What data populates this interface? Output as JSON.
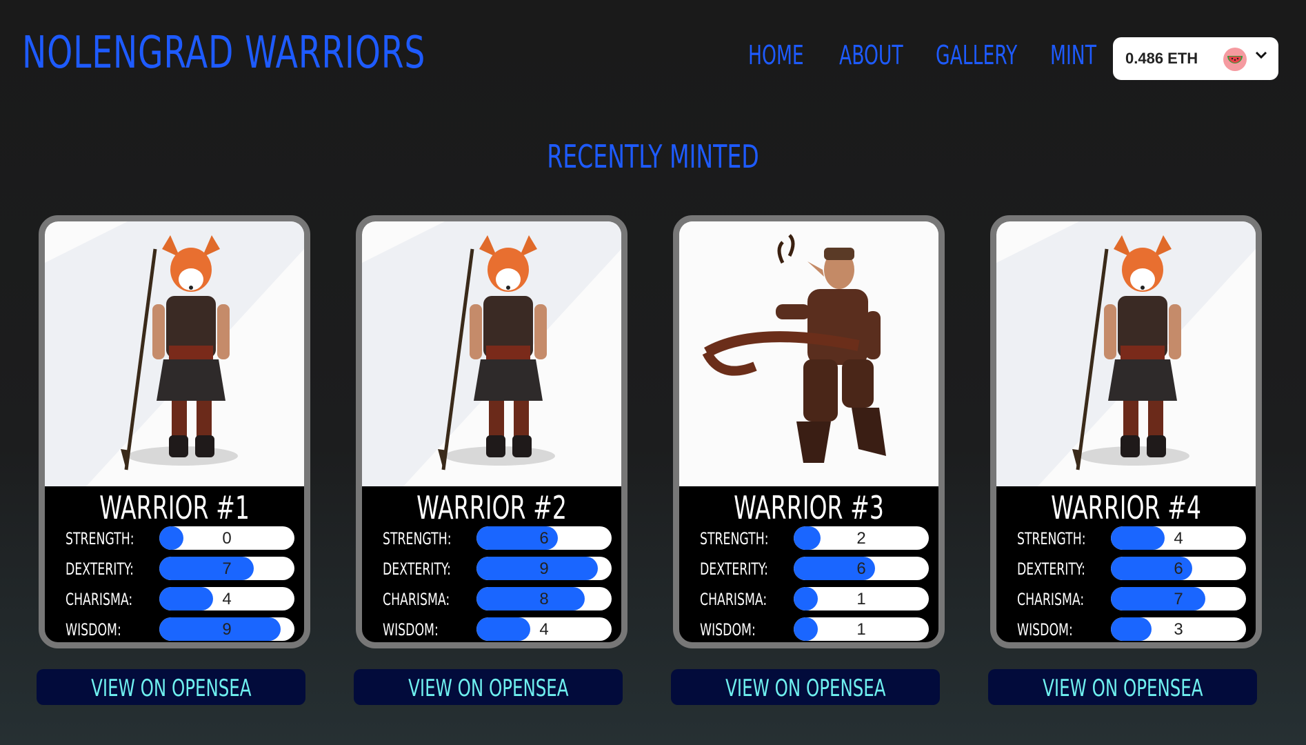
{
  "header": {
    "title": "NOLENGRAD WARRIORS",
    "nav": [
      "HOME",
      "ABOUT",
      "GALLERY",
      "MINT"
    ],
    "wallet": {
      "balance": "0.486 ETH",
      "avatar_icon": "watermelon-icon",
      "chevron_icon": "chevron-down-icon"
    }
  },
  "section": {
    "title": "RECENTLY MINTED"
  },
  "colors": {
    "accent": "#1e5bff",
    "bar_fill": "#1a66ff",
    "button_bg": "#020b3b",
    "button_text": "#6ff0f0"
  },
  "stat_max": 10,
  "cards": [
    {
      "title": "WARRIOR #1",
      "image": "fox-warrior-spear",
      "stats": [
        {
          "label": "STRENGTH:",
          "value": 0
        },
        {
          "label": "DEXTERITY:",
          "value": 7
        },
        {
          "label": "CHARISMA:",
          "value": 4
        },
        {
          "label": "WISDOM:",
          "value": 9
        }
      ],
      "button": "VIEW ON OPENSEA"
    },
    {
      "title": "WARRIOR #2",
      "image": "fox-warrior-spear",
      "stats": [
        {
          "label": "STRENGTH:",
          "value": 6
        },
        {
          "label": "DEXTERITY:",
          "value": 9
        },
        {
          "label": "CHARISMA:",
          "value": 8
        },
        {
          "label": "WISDOM:",
          "value": 4
        }
      ],
      "button": "VIEW ON OPENSEA"
    },
    {
      "title": "WARRIOR #3",
      "image": "elf-archer",
      "stats": [
        {
          "label": "STRENGTH:",
          "value": 2
        },
        {
          "label": "DEXTERITY:",
          "value": 6
        },
        {
          "label": "CHARISMA:",
          "value": 1
        },
        {
          "label": "WISDOM:",
          "value": 1
        }
      ],
      "button": "VIEW ON OPENSEA"
    },
    {
      "title": "WARRIOR #4",
      "image": "fox-warrior-spear",
      "stats": [
        {
          "label": "STRENGTH:",
          "value": 4
        },
        {
          "label": "DEXTERITY:",
          "value": 6
        },
        {
          "label": "CHARISMA:",
          "value": 7
        },
        {
          "label": "WISDOM:",
          "value": 3
        }
      ],
      "button": "VIEW ON OPENSEA"
    }
  ]
}
